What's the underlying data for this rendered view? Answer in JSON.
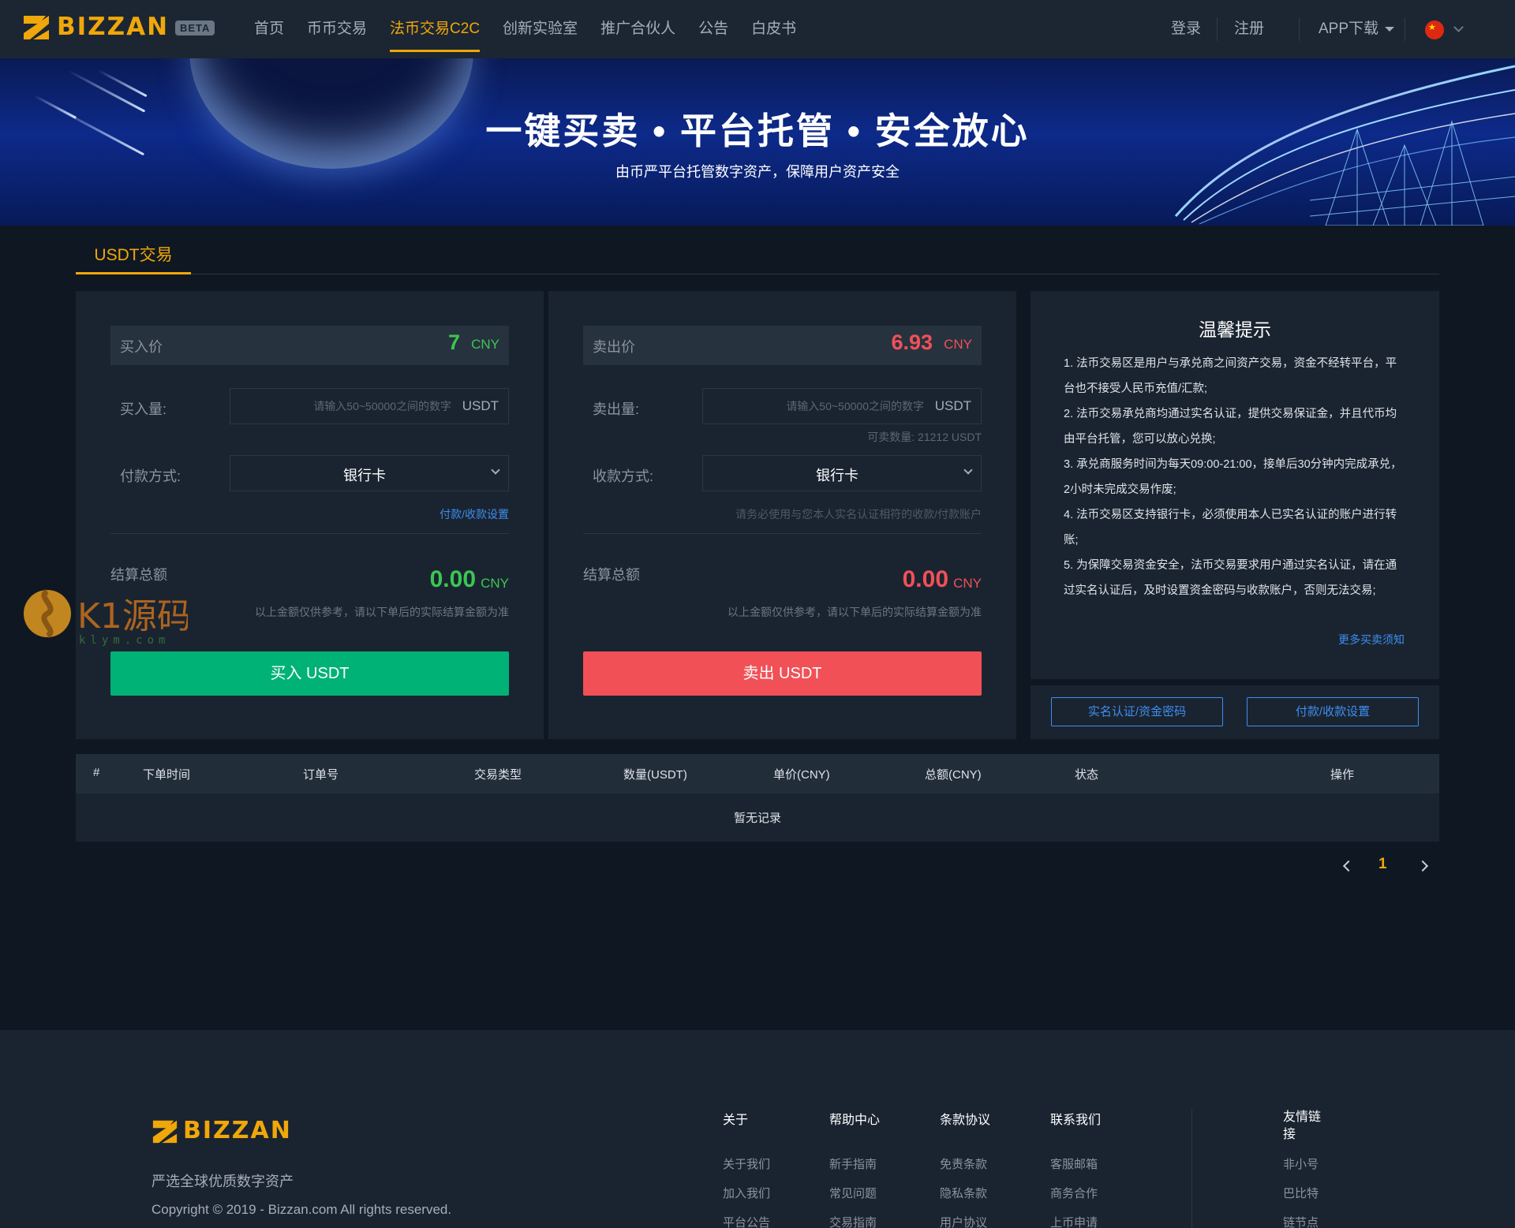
{
  "header": {
    "brand": "BIZZAN",
    "beta": "BETA",
    "nav": [
      "首页",
      "币币交易",
      "法币交易C2C",
      "创新实验室",
      "推广合伙人",
      "公告",
      "白皮书"
    ],
    "active_nav": "法币交易C2C",
    "login": "登录",
    "register": "注册",
    "app_download": "APP下载",
    "language_icon": "china-flag-icon"
  },
  "banner": {
    "title": "一键买卖 • 平台托管 • 安全放心",
    "subtitle": "由币严平台托管数字资产，保障用户资产安全"
  },
  "tab": {
    "label": "USDT交易"
  },
  "buy": {
    "price_label": "买入价",
    "price": "7",
    "currency": "CNY",
    "amount_label": "买入量:",
    "amount_placeholder": "请输入50~50000之间的数字",
    "amount_unit": "USDT",
    "method_label": "付款方式:",
    "method_value": "银行卡",
    "settings_link": "付款/收款设置",
    "total_label": "结算总额",
    "total_value": "0.00",
    "total_currency": "CNY",
    "total_note": "以上金额仅供参考，请以下单后的实际结算金额为准",
    "button": "买入 USDT"
  },
  "sell": {
    "price_label": "卖出价",
    "price": "6.93",
    "currency": "CNY",
    "amount_label": "卖出量:",
    "amount_placeholder": "请输入50~50000之间的数字",
    "amount_unit": "USDT",
    "available": "可卖数量:  21212 USDT",
    "method_label": "收款方式:",
    "method_value": "银行卡",
    "method_note": "请务必使用与您本人实名认证相符的收款/付款账户",
    "total_label": "结算总额",
    "total_value": "0.00",
    "total_currency": "CNY",
    "total_note": "以上金额仅供参考，请以下单后的实际结算金额为准",
    "button": "卖出 USDT"
  },
  "tips": {
    "title": "温馨提示",
    "items": [
      "1. 法币交易区是用户与承兑商之间资产交易，资金不经转平台，平台也不接受人民币充值/汇款;",
      "2. 法币交易承兑商均通过实名认证，提供交易保证金，并且代币均由平台托管，您可以放心兑换;",
      "3. 承兑商服务时间为每天09:00-21:00，接单后30分钟内完成承兑，2小时未完成交易作废;",
      "4. 法币交易区支持银行卡，必须使用本人已实名认证的账户进行转账;",
      "5. 为保障交易资金安全，法币交易要求用户通过实名认证，请在通过实名认证后，及时设置资金密码与收款账户，否则无法交易;"
    ],
    "more": "更多买卖须知",
    "btn_verify": "实名认证/资金密码",
    "btn_payment": "付款/收款设置"
  },
  "table": {
    "headers": [
      "#",
      "下单时间",
      "订单号",
      "交易类型",
      "数量(USDT)",
      "单价(CNY)",
      "总额(CNY)",
      "状态",
      "操作"
    ],
    "empty": "暂无记录",
    "page": "1"
  },
  "footer": {
    "brand": "BIZZAN",
    "slogan": "严选全球优质数字资产",
    "copyright": "Copyright © 2019 - Bizzan.com All rights reserved.",
    "columns": [
      {
        "title": "关于",
        "links": [
          "关于我们",
          "加入我们",
          "平台公告"
        ]
      },
      {
        "title": "帮助中心",
        "links": [
          "新手指南",
          "常见问题",
          "交易指南"
        ]
      },
      {
        "title": "条款协议",
        "links": [
          "免责条款",
          "隐私条款",
          "用户协议"
        ]
      },
      {
        "title": "联系我们",
        "links": [
          "客服邮箱",
          "商务合作",
          "上币申请"
        ]
      },
      {
        "title": "友情链接",
        "links": [
          "非小号",
          "巴比特",
          "链节点"
        ]
      }
    ]
  },
  "watermark": {
    "text": "K1源码",
    "domain": "k1ym.com"
  },
  "colors": {
    "accent": "#f0a70a",
    "buy": "#00b275",
    "sell": "#f15057",
    "link": "#3d8ef0",
    "bg": "#0f1822",
    "panel": "#1a2430"
  }
}
